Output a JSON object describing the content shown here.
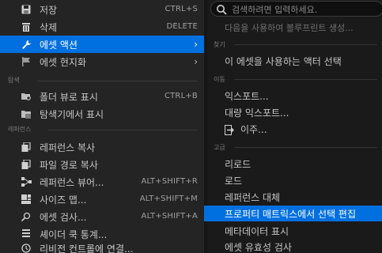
{
  "left_menu": {
    "items_top": [
      {
        "label": "저장",
        "shortcut": "CTRL+S",
        "icon": "save-icon"
      },
      {
        "label": "삭제",
        "shortcut": "DELETE",
        "icon": "trash-icon"
      },
      {
        "label": "에셋 액션",
        "icon": "wrench-icon",
        "highlighted": true
      },
      {
        "label": "에셋 현지화",
        "icon": "flag-icon"
      }
    ],
    "section_explore": "탐색",
    "items_explore": [
      {
        "label": "폴더 뷰로 표시",
        "shortcut": "CTRL+B",
        "icon": "folder-search-icon"
      },
      {
        "label": "탐색기에서 표시",
        "icon": "folder-icon"
      }
    ],
    "section_reference": "레퍼런스",
    "items_reference": [
      {
        "label": "레퍼런스 복사",
        "icon": "copy-icon"
      },
      {
        "label": "파일 경로 복사",
        "icon": "file-path-icon"
      },
      {
        "label": "레퍼런스 뷰어...",
        "shortcut": "ALT+SHIFT+R",
        "icon": "reference-viewer-icon"
      },
      {
        "label": "사이즈 맵...",
        "shortcut": "ALT+SHIFT+M",
        "icon": "size-map-icon"
      },
      {
        "label": "에셋 검사...",
        "shortcut": "ALT+SHIFT+A",
        "icon": "audit-icon"
      },
      {
        "label": "셰이더 쿡 통계...",
        "icon": "shader-stats-icon"
      },
      {
        "label": "리비전 컨트롤에 연결...",
        "icon": "revision-control-icon"
      }
    ]
  },
  "right_menu": {
    "search_placeholder": "검색하려면 입력하세요.",
    "hint": "다음을 사용하여 블루프린트 생성...",
    "section_find": "찾기",
    "find_items": [
      "이 에셋을 사용하는 액터 선택"
    ],
    "section_move": "이동",
    "move_items": [
      "익스포트...",
      "대량 익스포트..."
    ],
    "migrate_label": "이주...",
    "section_advanced": "고급",
    "advanced_items": [
      {
        "label": "리로드"
      },
      {
        "label": "로드"
      },
      {
        "label": "레퍼런스 대체"
      },
      {
        "label": "프로퍼티 매트릭스에서 선택 편집",
        "highlighted": true
      },
      {
        "label": "메타데이터 표시"
      },
      {
        "label": "에셋 유효성 검사"
      }
    ]
  },
  "colors": {
    "highlight": "#0070e0",
    "menu_bg": "#242424",
    "submenu_bg": "#1a1a1a"
  }
}
